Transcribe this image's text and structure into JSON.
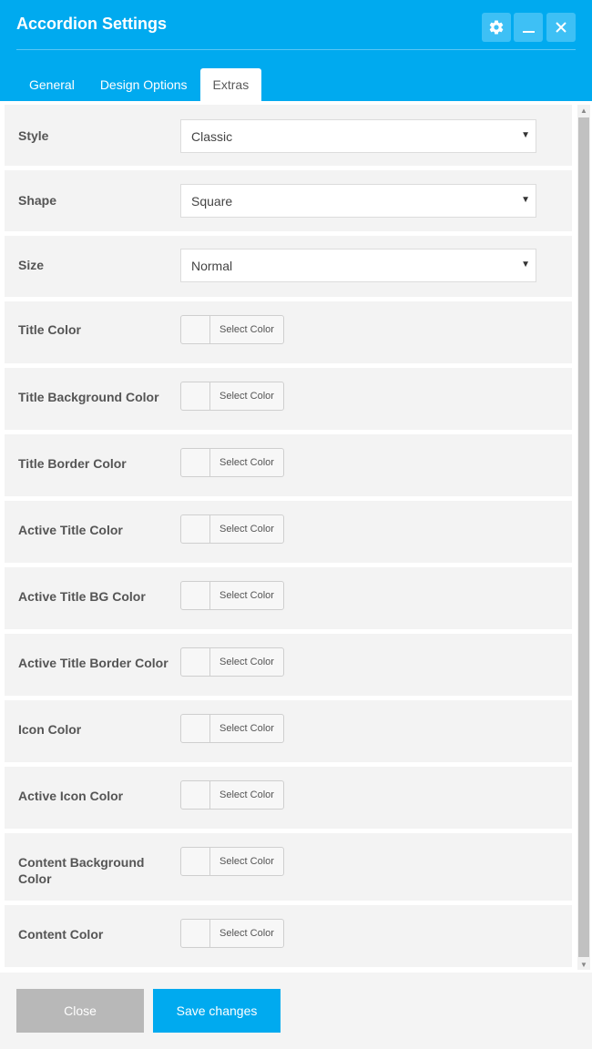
{
  "window": {
    "title": "Accordion Settings",
    "header_color": "#00aaef",
    "icons": {
      "settings": "gear-icon",
      "minimize": "minimize-icon",
      "close": "close-icon"
    }
  },
  "tabs": [
    {
      "label": "General",
      "active": false
    },
    {
      "label": "Design Options",
      "active": false
    },
    {
      "label": "Extras",
      "active": true
    }
  ],
  "fields": {
    "style": {
      "label": "Style",
      "value": "Classic"
    },
    "shape": {
      "label": "Shape",
      "value": "Square"
    },
    "size": {
      "label": "Size",
      "value": "Normal"
    },
    "title_color": {
      "label": "Title Color",
      "button": "Select Color"
    },
    "title_bg_color": {
      "label": "Title Background Color",
      "button": "Select Color"
    },
    "title_border_color": {
      "label": "Title Border Color",
      "button": "Select Color"
    },
    "active_title_color": {
      "label": "Active Title Color",
      "button": "Select Color"
    },
    "active_title_bg_color": {
      "label": "Active Title BG Color",
      "button": "Select Color"
    },
    "active_title_border_color": {
      "label": "Active Title Border Color",
      "button": "Select Color"
    },
    "icon_color": {
      "label": "Icon Color",
      "button": "Select Color"
    },
    "active_icon_color": {
      "label": "Active Icon Color",
      "button": "Select Color"
    },
    "content_bg_color": {
      "label": "Content Background Color",
      "button": "Select Color"
    },
    "content_color": {
      "label": "Content Color",
      "button": "Select Color"
    }
  },
  "footer": {
    "close_label": "Close",
    "save_label": "Save changes",
    "save_color": "#00aaef",
    "close_color": "#b8b8b8"
  }
}
